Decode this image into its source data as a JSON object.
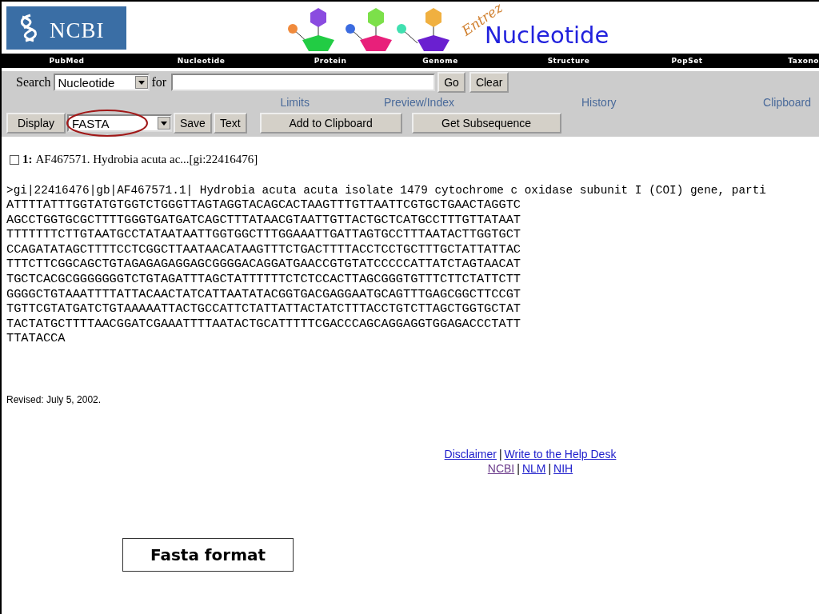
{
  "logo": {
    "text": "NCBI"
  },
  "banner": {
    "script_text": "Entrez",
    "title": "Nucleotide"
  },
  "nav": [
    "PubMed",
    "Nucleotide",
    "Protein",
    "Genome",
    "Structure",
    "PopSet",
    "Taxono"
  ],
  "search": {
    "label": "Search",
    "database": "Nucleotide",
    "for_label": "for",
    "buttons": [
      "Go",
      "Clear"
    ]
  },
  "links": [
    "Limits",
    "Preview/Index",
    "History",
    "Clipboard"
  ],
  "display": {
    "label": "Display",
    "format": "FASTA",
    "format_highlighted": true,
    "buttons": [
      {
        "label": "Save",
        "kind": "small"
      },
      {
        "label": "Text",
        "kind": "small"
      },
      {
        "label": "Add to Clipboard",
        "kind": "wide"
      },
      {
        "label": "Get Subsequence",
        "kind": "wide"
      }
    ]
  },
  "record": {
    "checked": false,
    "number": "1:",
    "title": "AF467571. Hydrobia acuta ac...[gi:22416476]"
  },
  "fasta": {
    "header": ">gi|22416476|gb|AF467571.1| Hydrobia acuta acuta isolate 1479 cytochrome c oxidase subunit I (COI) gene, parti",
    "sequence": [
      "ATTTTATTTGGTATGTGGTCTGGGTTAGTAGGTACAGCACTAAGTTTGTTAATTCGTGCTGAACTAGGTC",
      "AGCCTGGTGCGCTTTTGGGTGATGATCAGCTTTATAACGTAATTGTTACTGCTCATGCCTTTGTTATAAT",
      "TTTTTTTCTTGTAATGCCTATAATAATTGGTGGCTTTGGAAATTGATTAGTGCCTTTAATACTTGGTGCT",
      "CCAGATATAGCTTTTCCTCGGCTTAATAACATAAGTTTCTGACTTTTACCTCCTGCTTTGCTATTATTAC",
      "TTTCTTCGGCAGCTGTAGAGAGAGGAGCGGGGACAGGATGAACCGTGTATCCCCCATTATCTAGTAACAT",
      "TGCTCACGCGGGGGGGTCTGTAGATTTAGCTATTTTTTCTCTCCACTTAGCGGGTGTTTCTTCTATTCTT",
      "GGGGCTGTAAATTTTATTACAACTATCATTAATATACGGTGACGAGGAATGCAGTTTGAGCGGCTTCCGT",
      "TGTTCGTATGATCTGTAAAAATTACTGCCATTCTATTATTACTATCTTTACCTGTCTTAGCTGGTGCTAT",
      "TACTATGCTTTTAACGGATCGAAATTTTAATACTGCATTTTTCGACCCAGCAGGAGGTGGAGACCCTATT",
      "TTATACCA"
    ]
  },
  "revised": "Revised: July 5, 2002.",
  "footer": {
    "separator": "|",
    "rows": [
      [
        {
          "label": "Disclaimer",
          "visited": false
        },
        {
          "label": "Write to the Help Desk",
          "visited": false
        }
      ],
      [
        {
          "label": "NCBI",
          "visited": true
        },
        {
          "label": "NLM",
          "visited": false
        },
        {
          "label": "NIH",
          "visited": false
        }
      ]
    ]
  },
  "callout": {
    "text": "Fasta format"
  }
}
